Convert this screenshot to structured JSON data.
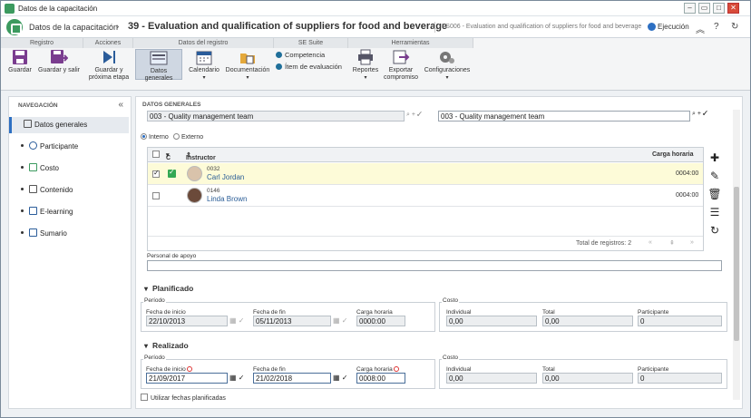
{
  "window": {
    "title": "Datos de la capacitación"
  },
  "header": {
    "breadcrumb": "Datos de la capacitación",
    "title": "39 - Evaluation and qualification of suppliers for food and beverage",
    "subtitle": "FS006 - Evaluation and qualification of suppliers for food and beverage",
    "execution": "Ejecución"
  },
  "ribbon": {
    "groups": [
      "Registro",
      "Acciones",
      "Datos del registro",
      "SE Suite",
      "Herramientas"
    ],
    "save": "Guardar",
    "save_exit": "Guardar y salir",
    "save_next": "Guardar y próxima etapa",
    "general": "Datos generales",
    "calendar": "Calendario",
    "docs": "Documentación",
    "competence": "Competencia",
    "eval_item": "Ítem de evaluación",
    "reports": "Reportes",
    "export": "Exportar compromiso",
    "settings": "Configuraciones"
  },
  "nav": {
    "header": "NAVEGACIÓN",
    "items": [
      "Datos generales",
      "Participante",
      "Costo",
      "Contenido",
      "E-learning",
      "Sumario"
    ]
  },
  "content": {
    "header": "DATOS GENERALES",
    "team_left": "003 - Quality management team",
    "team_right": "003 - Quality management team",
    "radio_internal": "Interno",
    "radio_external": "Externo",
    "grid": {
      "col_c": "C",
      "col_instructor": "Instructor",
      "col_hours": "Carga horaria",
      "rows": [
        {
          "code": "0032",
          "name": "Carl Jordan",
          "hours": "0004:00"
        },
        {
          "code": "0146",
          "name": "Linda Brown",
          "hours": "0004:00"
        }
      ],
      "total": "Total de registros: 2"
    },
    "support_label": "Personal de apoyo",
    "planned": {
      "title": "Planificado",
      "period": "Período",
      "start_label": "Fecha de inicio",
      "start": "22/10/2013",
      "end_label": "Fecha de fin",
      "end": "05/11/2013",
      "load_label": "Carga horaria",
      "load": "0000:00",
      "cost": "Costo",
      "ind_label": "Individual",
      "ind": "0,00",
      "tot_label": "Total",
      "tot": "0,00",
      "part_label": "Participante",
      "part": "0"
    },
    "actual": {
      "title": "Realizado",
      "period": "Período",
      "start_label": "Fecha de inicio",
      "start": "21/09/2017",
      "end_label": "Fecha de fin",
      "end": "21/02/2018",
      "load_label": "Carga horaria",
      "load": "0008:00",
      "cost": "Costo",
      "ind_label": "Individual",
      "ind": "0,00",
      "tot_label": "Total",
      "tot": "0,00",
      "part_label": "Participante",
      "part": "0"
    },
    "use_planned": "Utilizar fechas planificadas"
  }
}
